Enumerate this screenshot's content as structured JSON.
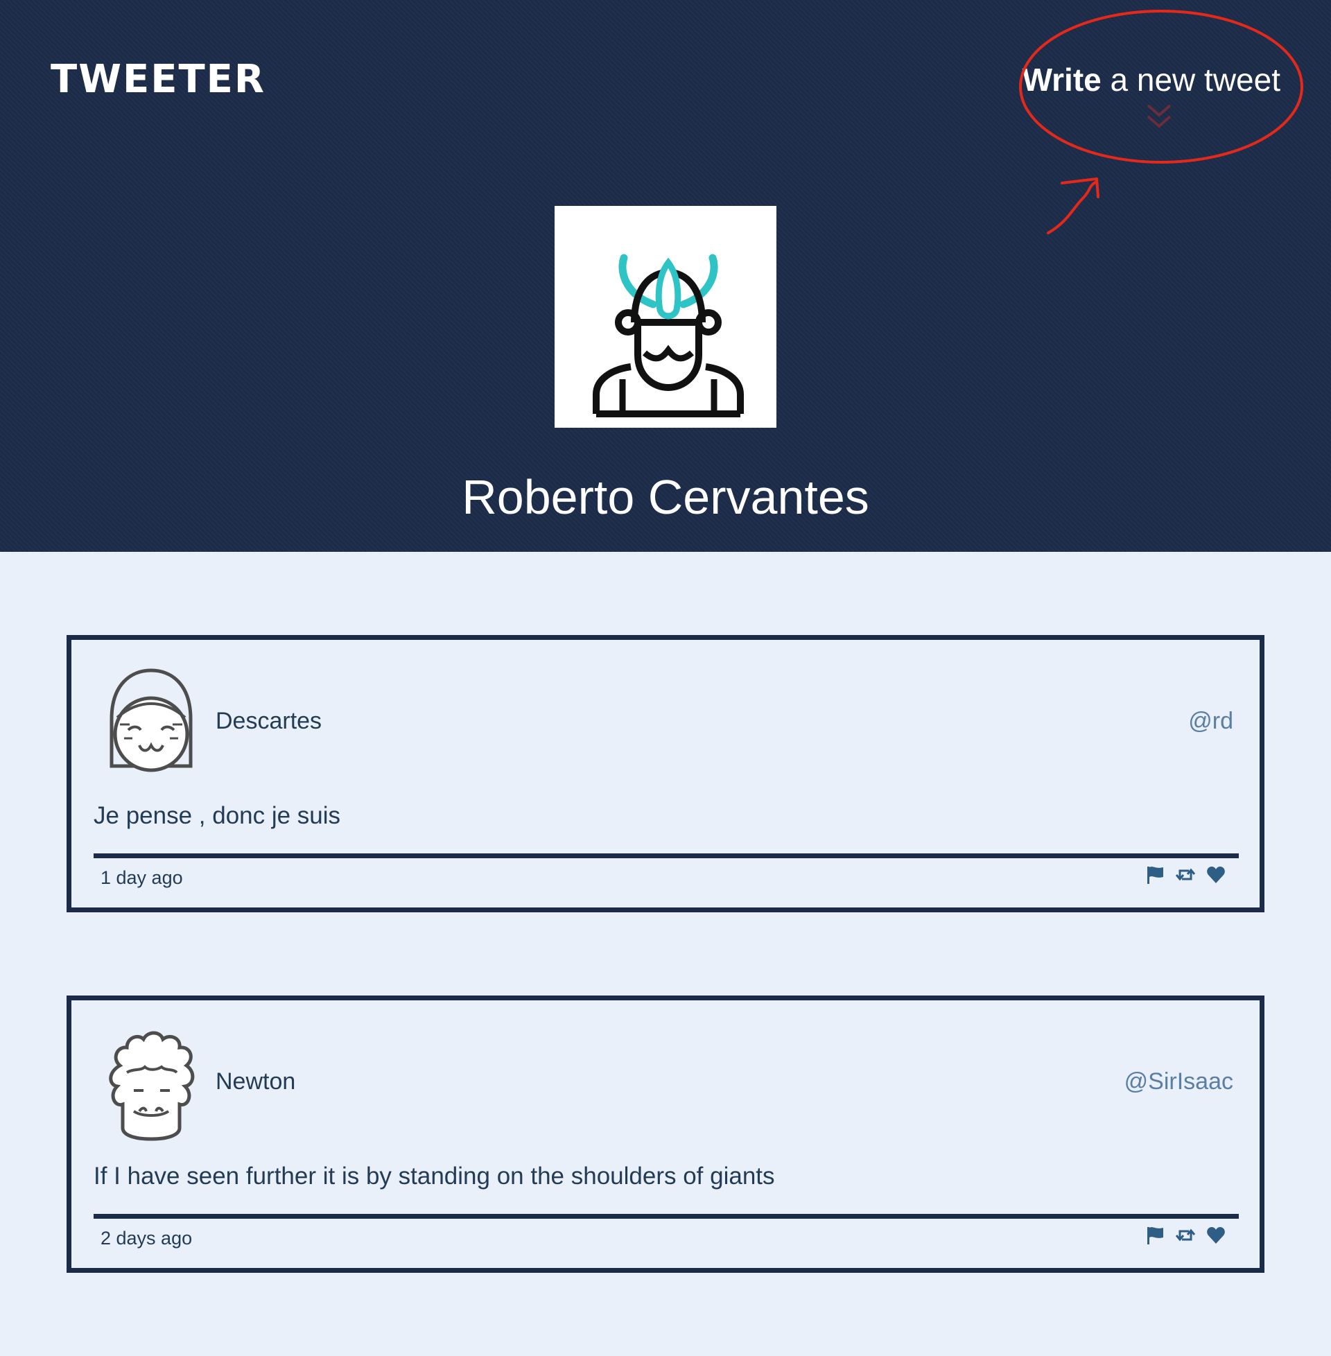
{
  "app": {
    "brand": "TWEETER"
  },
  "compose": {
    "bold_label": "Write",
    "rest_label": " a new tweet",
    "icon": "double-chevron-down-icon"
  },
  "profile": {
    "name": "Roberto Cervantes",
    "avatar_icon": "viking-avatar-icon"
  },
  "colors": {
    "header_bg": "#1c2b48",
    "page_bg": "#e9f0f9",
    "accent_teal": "#2ec4c6",
    "annotation_red": "#e3291b",
    "handle_blue": "#5a7fa3"
  },
  "tweets": [
    {
      "author": "Descartes",
      "handle": "@rd",
      "text": "Je pense , donc je suis",
      "time": "1 day ago",
      "avatar_icon": "girl-face-avatar-icon",
      "actions": [
        "flag-icon",
        "retweet-icon",
        "heart-icon"
      ]
    },
    {
      "author": "Newton",
      "handle": "@SirIsaac",
      "text": "If I have seen further it is by standing on the shoulders of giants",
      "time": "2 days ago",
      "avatar_icon": "curly-hair-face-avatar-icon",
      "actions": [
        "flag-icon",
        "retweet-icon",
        "heart-icon"
      ]
    }
  ]
}
